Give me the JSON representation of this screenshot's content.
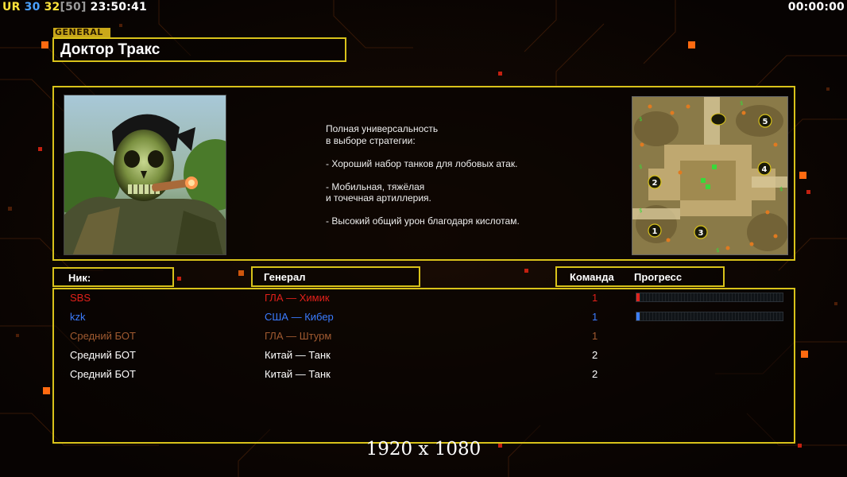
{
  "hud": {
    "ur_label": "UR",
    "val1": "30",
    "val2": "32",
    "val3": "[50]",
    "clock": "23:50:41",
    "timer": "00:00:00"
  },
  "general_tag": "GENERAL",
  "general_name": "Доктор Тракс",
  "description": [
    "Полная универсальность",
    "в выборе стратегии:",
    "",
    "- Хороший набор танков для лобовых атак.",
    "",
    "- Мобильная, тяжёлая",
    "и точечная артиллерия.",
    "",
    "- Высокий общий урон благодаря кислотам."
  ],
  "headers": {
    "nick": "Ник:",
    "general": "Генерал",
    "team": "Команда",
    "progress": "Прогресс"
  },
  "players": [
    {
      "nick": "SBS",
      "general": "ГЛА — Химик",
      "team": "1",
      "color": "#e0201a",
      "progress": 0.02,
      "show_progress": true
    },
    {
      "nick": "kzk",
      "general": "США — Кибер",
      "team": "1",
      "color": "#3a7cff",
      "progress": 0.01,
      "show_progress": true
    },
    {
      "nick": "Средний БОТ",
      "general": "ГЛА — Штурм",
      "team": "1",
      "color": "#a05a30",
      "progress": 0,
      "show_progress": false
    },
    {
      "nick": "Средний БОТ",
      "general": "Китай — Танк",
      "team": "2",
      "color": "#ffffff",
      "progress": 0,
      "show_progress": false
    },
    {
      "nick": "Средний БОТ",
      "general": "Китай — Танк",
      "team": "2",
      "color": "#ffffff",
      "progress": 0,
      "show_progress": false
    }
  ],
  "minimap_spots": [
    "1",
    "2",
    "3",
    "4",
    "5"
  ],
  "resolution": "1920 x 1080",
  "colors": {
    "frame": "#d8c21a",
    "accent_orange": "#ff7a10"
  }
}
